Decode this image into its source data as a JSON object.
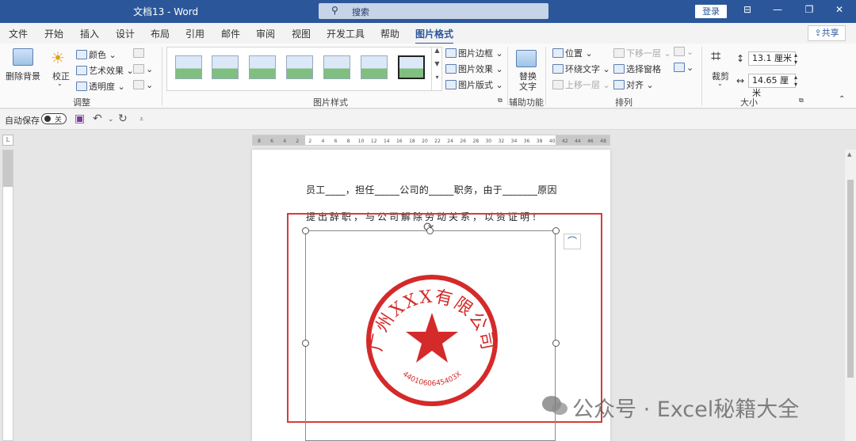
{
  "titlebar": {
    "title": "文档13  -  Word",
    "search_placeholder": "搜索",
    "login": "登录"
  },
  "tabs": [
    "文件",
    "开始",
    "插入",
    "设计",
    "布局",
    "引用",
    "邮件",
    "审阅",
    "视图",
    "开发工具",
    "帮助",
    "图片格式"
  ],
  "active_tab": "图片格式",
  "share": "共享",
  "ribbon": {
    "remove_bg": "删除背景",
    "corrections": "校正",
    "color": "颜色",
    "artistic": "艺术效果",
    "transparency": "透明度",
    "group_adjust": "调整",
    "picture_border": "图片边框",
    "picture_effects": "图片效果",
    "picture_layout": "图片版式",
    "group_styles": "图片样式",
    "alt_text_1": "替换",
    "alt_text_2": "文字",
    "group_accessibility": "辅助功能",
    "position": "位置",
    "wrap_text": "环绕文字",
    "bring_forward": "上移一层",
    "send_backward": "下移一层",
    "selection_pane": "选择窗格",
    "align": "对齐",
    "group_arrange": "排列",
    "crop": "裁剪",
    "height": "13.1 厘米",
    "width": "14.65 厘米",
    "group_size": "大小"
  },
  "qat": {
    "autosave": "自动保存",
    "toggle_state": "关"
  },
  "ruler": {
    "marks": [
      "8",
      "6",
      "4",
      "2",
      "2",
      "4",
      "6",
      "8",
      "10",
      "12",
      "14",
      "16",
      "18",
      "20",
      "22",
      "24",
      "26",
      "28",
      "30",
      "32",
      "34",
      "36",
      "38",
      "40",
      "42",
      "44",
      "46",
      "48"
    ]
  },
  "document": {
    "line1": "员工____，担任_____公司的_____职务，由于_______原因",
    "line2": "提出辞职，与公司解除劳动关系，以资证明！"
  },
  "seal": {
    "company": "广州XXX有限公司",
    "number": "4401060645403X",
    "color": "#d42a2a"
  },
  "watermark": "公众号 · Excel秘籍大全",
  "colors": {
    "brand": "#2b579a",
    "frame": "#d63b3b"
  }
}
